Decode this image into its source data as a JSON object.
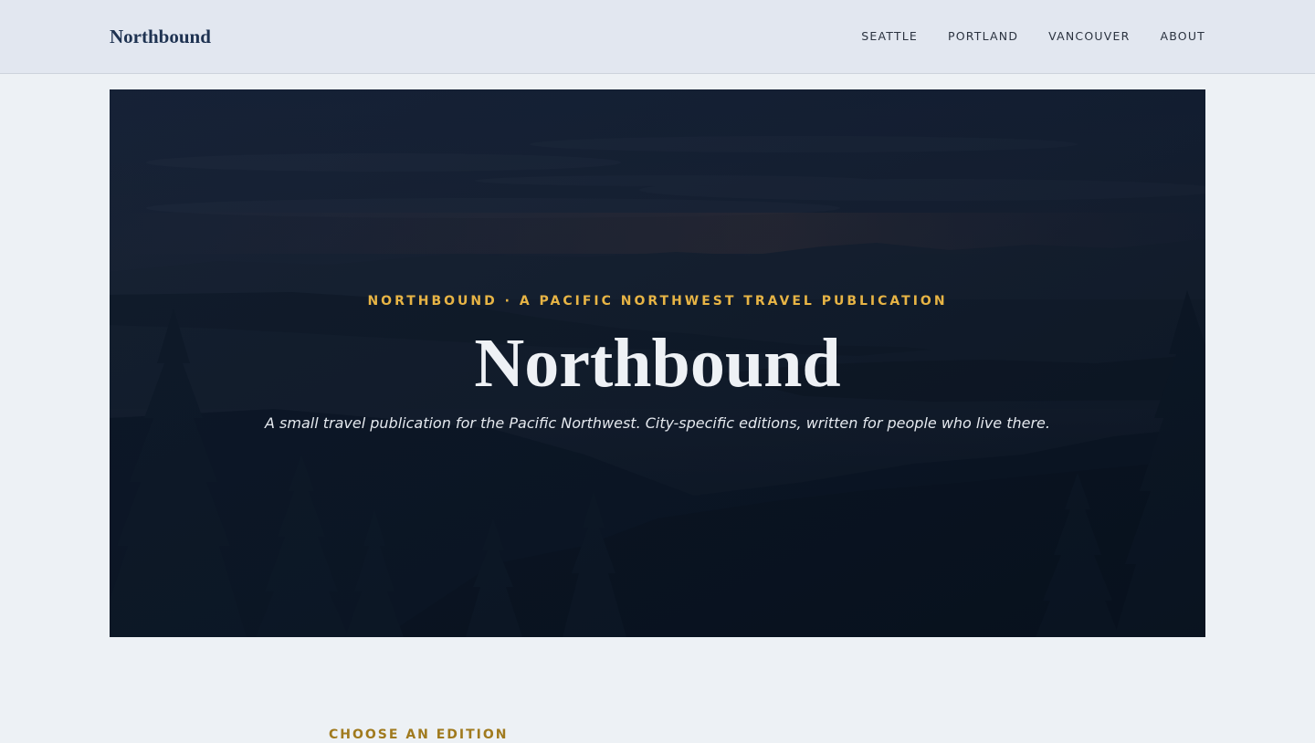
{
  "header": {
    "brand": "Northbound",
    "nav": [
      {
        "label": "SEATTLE"
      },
      {
        "label": "PORTLAND"
      },
      {
        "label": "VANCOUVER"
      },
      {
        "label": "ABOUT"
      }
    ]
  },
  "hero": {
    "eyebrow": "NORTHBOUND · A PACIFIC NORTHWEST TRAVEL PUBLICATION",
    "title": "Northbound",
    "tagline": "A small travel publication for the Pacific Northwest. City-specific editions, written for people who live there."
  },
  "editions": {
    "label": "CHOOSE AN EDITION"
  },
  "colors": {
    "accent": "#e7b445",
    "brand": "#1f3352",
    "hero_bg": "#0c1727",
    "page_bg": "#edf1f5"
  }
}
